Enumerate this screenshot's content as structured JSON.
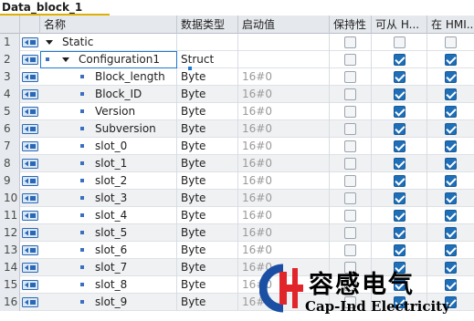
{
  "window": {
    "title": "Data_block_1"
  },
  "columns": {
    "name": "名称",
    "datatype": "数据类型",
    "start_value": "启动值",
    "retain": "保持性",
    "hmi_accessible": "可从 H...",
    "hmi_visible": "在 HMI..."
  },
  "rows": [
    {
      "num": "1",
      "name": "Static",
      "level": 0,
      "expand": true,
      "type": "",
      "start": "",
      "retain": false,
      "hmi1": false,
      "hmi2": false
    },
    {
      "num": "2",
      "name": "Configuration1",
      "level": 1,
      "expand": true,
      "type": "Struct",
      "start": "",
      "retain": false,
      "hmi1": true,
      "hmi2": true
    },
    {
      "num": "3",
      "name": "Block_length",
      "level": 2,
      "expand": false,
      "type": "Byte",
      "start": "16#0",
      "retain": false,
      "hmi1": true,
      "hmi2": true
    },
    {
      "num": "4",
      "name": "Block_ID",
      "level": 2,
      "expand": false,
      "type": "Byte",
      "start": "16#0",
      "retain": false,
      "hmi1": true,
      "hmi2": true
    },
    {
      "num": "5",
      "name": "Version",
      "level": 2,
      "expand": false,
      "type": "Byte",
      "start": "16#0",
      "retain": false,
      "hmi1": true,
      "hmi2": true
    },
    {
      "num": "6",
      "name": "Subversion",
      "level": 2,
      "expand": false,
      "type": "Byte",
      "start": "16#0",
      "retain": false,
      "hmi1": true,
      "hmi2": true
    },
    {
      "num": "7",
      "name": "slot_0",
      "level": 2,
      "expand": false,
      "type": "Byte",
      "start": "16#0",
      "retain": false,
      "hmi1": true,
      "hmi2": true
    },
    {
      "num": "8",
      "name": "slot_1",
      "level": 2,
      "expand": false,
      "type": "Byte",
      "start": "16#0",
      "retain": false,
      "hmi1": true,
      "hmi2": true
    },
    {
      "num": "9",
      "name": "slot_2",
      "level": 2,
      "expand": false,
      "type": "Byte",
      "start": "16#0",
      "retain": false,
      "hmi1": true,
      "hmi2": true
    },
    {
      "num": "10",
      "name": "slot_3",
      "level": 2,
      "expand": false,
      "type": "Byte",
      "start": "16#0",
      "retain": false,
      "hmi1": true,
      "hmi2": true
    },
    {
      "num": "11",
      "name": "slot_4",
      "level": 2,
      "expand": false,
      "type": "Byte",
      "start": "16#0",
      "retain": false,
      "hmi1": true,
      "hmi2": true
    },
    {
      "num": "12",
      "name": "slot_5",
      "level": 2,
      "expand": false,
      "type": "Byte",
      "start": "16#0",
      "retain": false,
      "hmi1": true,
      "hmi2": true
    },
    {
      "num": "13",
      "name": "slot_6",
      "level": 2,
      "expand": false,
      "type": "Byte",
      "start": "16#0",
      "retain": false,
      "hmi1": true,
      "hmi2": true
    },
    {
      "num": "14",
      "name": "slot_7",
      "level": 2,
      "expand": false,
      "type": "Byte",
      "start": "16#0",
      "retain": false,
      "hmi1": true,
      "hmi2": true
    },
    {
      "num": "15",
      "name": "slot_8",
      "level": 2,
      "expand": false,
      "type": "Byte",
      "start": "16#0",
      "retain": false,
      "hmi1": true,
      "hmi2": true
    },
    {
      "num": "16",
      "name": "slot_9",
      "level": 2,
      "expand": false,
      "type": "Byte",
      "start": "16#0",
      "retain": false,
      "hmi1": true,
      "hmi2": true
    }
  ],
  "selected_row": "2",
  "watermark": {
    "cn": "容感电气",
    "en": "Cap-Ind Electricity"
  },
  "colors": {
    "accent": "#1f6fb8",
    "header_bg": "#e5e8ec",
    "tab_underline": "#e0b000",
    "logo_red": "#e0262b",
    "logo_blue": "#1b4fa3"
  },
  "icons": {
    "row_type": "db-member-icon",
    "expand": "expand-triangle-icon",
    "struct_button": "struct-editor-icon"
  }
}
